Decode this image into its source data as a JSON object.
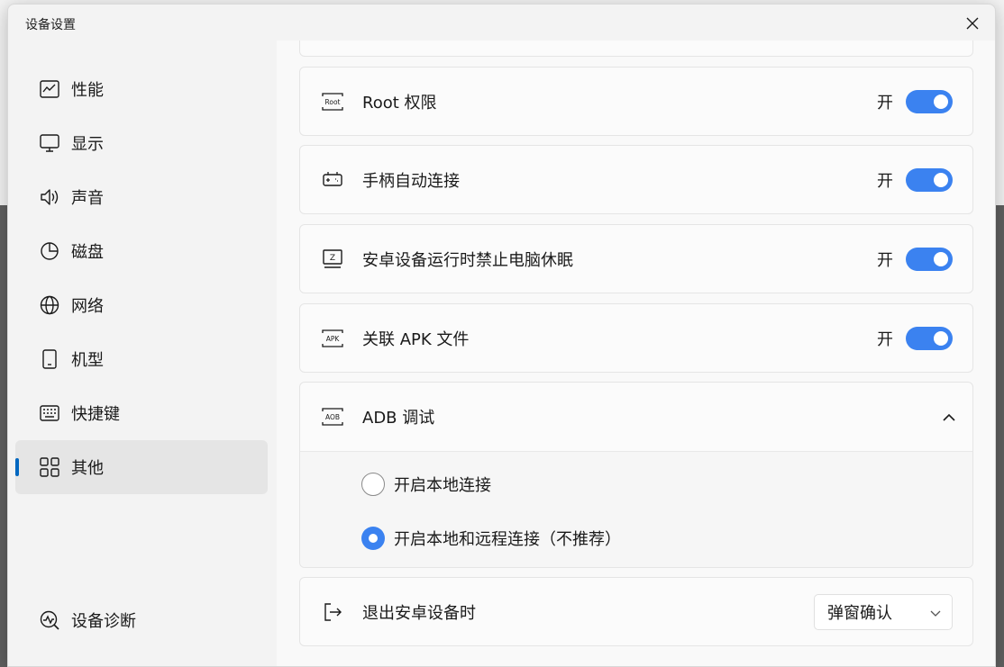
{
  "window": {
    "title": "设备设置"
  },
  "sidebar": {
    "items": [
      {
        "label": "性能",
        "icon": "performance-chart-icon"
      },
      {
        "label": "显示",
        "icon": "monitor-icon"
      },
      {
        "label": "声音",
        "icon": "speaker-icon"
      },
      {
        "label": "磁盘",
        "icon": "disk-pie-icon"
      },
      {
        "label": "网络",
        "icon": "globe-icon"
      },
      {
        "label": "机型",
        "icon": "phone-icon"
      },
      {
        "label": "快捷键",
        "icon": "keyboard-icon"
      },
      {
        "label": "其他",
        "icon": "grid-icon",
        "active": true
      }
    ],
    "diagnose": {
      "label": "设备诊断",
      "icon": "diagnose-icon"
    }
  },
  "settings": {
    "root": {
      "label": "Root 权限",
      "state_text": "开",
      "icon_text": "Root",
      "on": true
    },
    "gamepad": {
      "label": "手柄自动连接",
      "state_text": "开",
      "on": true
    },
    "nosleep": {
      "label": "安卓设备运行时禁止电脑休眠",
      "state_text": "开",
      "icon_text": "Z",
      "on": true
    },
    "apk": {
      "label": "关联 APK 文件",
      "state_text": "开",
      "icon_text": "APK",
      "on": true
    },
    "adb": {
      "label": "ADB 调试",
      "icon_text": "AOB",
      "expanded": true,
      "options": [
        {
          "label": "开启本地连接",
          "checked": false
        },
        {
          "label": "开启本地和远程连接（不推荐）",
          "checked": true
        }
      ]
    },
    "exit": {
      "label": "退出安卓设备时",
      "selected": "弹窗确认"
    }
  },
  "colors": {
    "accent": "#3b82f0",
    "nav_indicator": "#0067c0"
  }
}
